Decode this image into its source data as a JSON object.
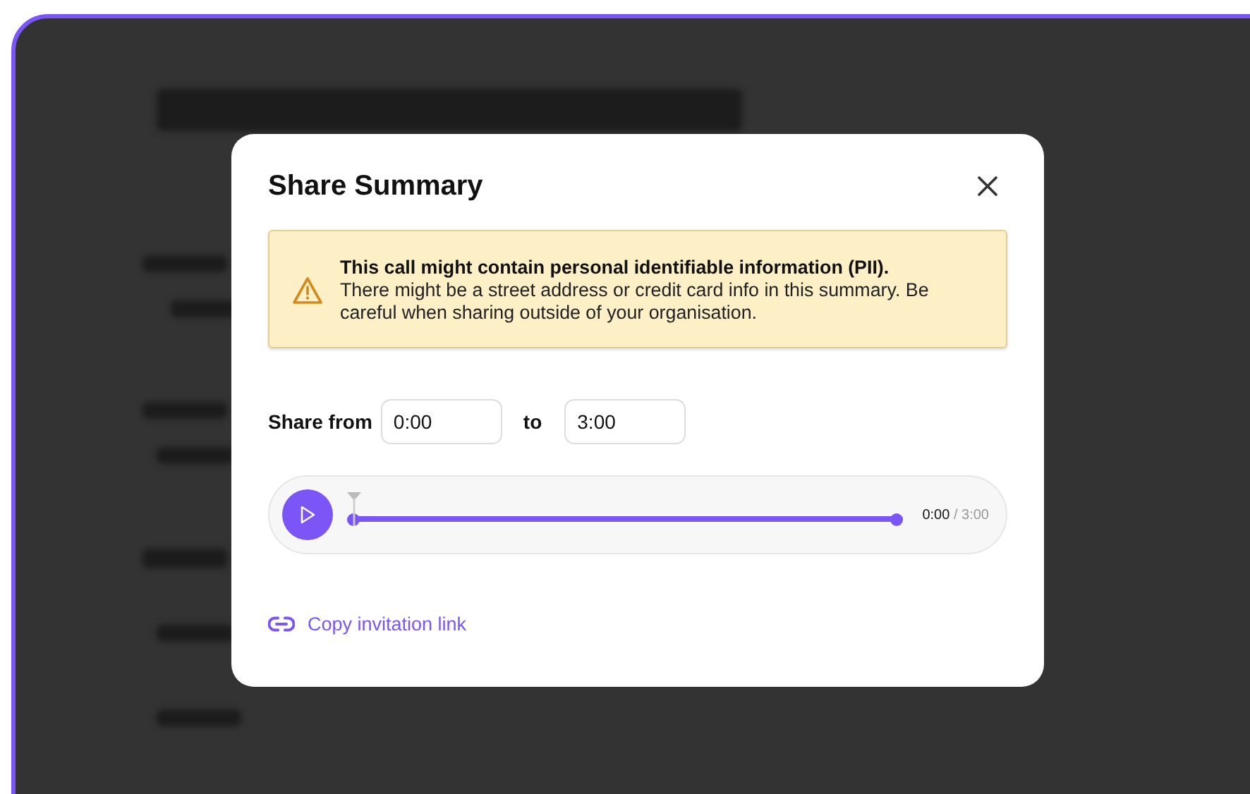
{
  "dialog": {
    "title": "Share Summary",
    "alert": {
      "heading": "This call might contain personal identifiable information (PII).",
      "body": "There might be a street address or credit card info in this summary. Be careful when sharing outside of your organisation."
    },
    "range": {
      "from_label": "Share from",
      "from_value": "0:00",
      "to_label": "to",
      "to_value": "3:00"
    },
    "player": {
      "level": 0,
      "current": "0:00",
      "total": "/ 3:00"
    },
    "link": "Copy invitation link"
  }
}
